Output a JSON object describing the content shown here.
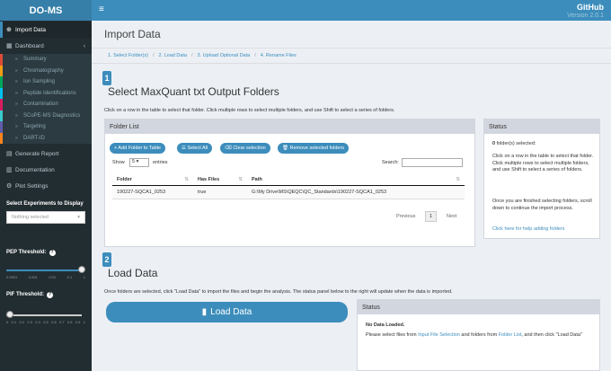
{
  "app": {
    "title": "DO-MS",
    "github": "GitHub",
    "version": "Version 2.0.1"
  },
  "sidebar": {
    "items_top": [
      {
        "label": "Import Data",
        "icon": "import-icon"
      },
      {
        "label": "Dashboard",
        "icon": "dashboard-icon"
      }
    ],
    "sub_items": [
      {
        "label": "Summary",
        "color": "#dd4b39"
      },
      {
        "label": "Chromatography",
        "color": "#f39c12"
      },
      {
        "label": "Ion Sampling",
        "color": "#00a65a"
      },
      {
        "label": "Peptide Identifications",
        "color": "#00c0ef"
      },
      {
        "label": "Contamination",
        "color": "#d81b60"
      },
      {
        "label": "SCoPE-MS Diagnostics",
        "color": "#39cccc"
      },
      {
        "label": "Targeting",
        "color": "#605ca8"
      },
      {
        "label": "DART-ID",
        "color": "#ff851b"
      }
    ],
    "items_bottom": [
      {
        "label": "Generate Report",
        "icon": "report-icon"
      },
      {
        "label": "Documentation",
        "icon": "book-icon"
      },
      {
        "label": "Plot Settings",
        "icon": "gear-icon"
      }
    ],
    "select_label": "Select Experiments to Display",
    "select_placeholder": "Nothing selected",
    "pep_label": "PEP Threshold:",
    "pep_ticks": [
      "0.0001",
      "0.001",
      "0.01",
      "0.1",
      "1"
    ],
    "pif_label": "PIF Threshold:",
    "pif_ticks": [
      "0",
      "0.1",
      "0.2",
      "0.3",
      "0.4",
      "0.5",
      "0.6",
      "0.7",
      "0.8",
      "0.9",
      "1"
    ]
  },
  "page": {
    "title": "Import Data",
    "steps": [
      "1. Select Folder(s)",
      "2. Load Data",
      "3. Upload Optional Data",
      "4. Rename Files"
    ],
    "section1": {
      "num": "1",
      "title": "Select MaxQuant txt Output Folders",
      "desc": "Click on a row in the table to select that folder. Click multiple rows to select multiple folders, and use Shift to select a series of folders."
    },
    "folder_list": {
      "title": "Folder List",
      "buttons": {
        "add": "+ Add Folder to Table",
        "select_all": "Select All",
        "clear": "Clear selection",
        "remove": "Remove selected folders"
      },
      "show": "Show",
      "entries": "entries",
      "show_value": "5",
      "search": "Search:",
      "columns": [
        "Folder",
        "Has Files",
        "Path"
      ],
      "rows": [
        {
          "folder": "190227-SQCA1_0253",
          "has": "true",
          "path": "G:\\My Drive\\MS\\QEQC\\QC_Standards\\190227-SQCA1_0253"
        }
      ],
      "prev": "Previous",
      "page": "1",
      "next": "Next"
    },
    "status1": {
      "title": "Status",
      "count": "0",
      "selected": "folder(s) selected:",
      "p1": "Click on a row in the table to select that folder. Click multiple rows to select multiple folders, and use Shift to select a series of folders.",
      "p2": "Once you are finished selecting folders, scroll down to continue the import process.",
      "link": "Click here for help adding folders"
    },
    "section2": {
      "num": "2",
      "title": "Load Data",
      "desc": "Once folders are selected, click \"Load Data\" to import the files and begin the analysis. The status panel below to the right will update when the data is imported."
    },
    "load_btn": "Load Data",
    "status2": {
      "title": "Status",
      "bold": "No Data Loaded.",
      "t1": "Please select files from",
      "l1": "Input File Selection",
      "t2": "and folders from",
      "l2": "Folder List",
      "t3": ", and then click \"Load Data\""
    }
  }
}
